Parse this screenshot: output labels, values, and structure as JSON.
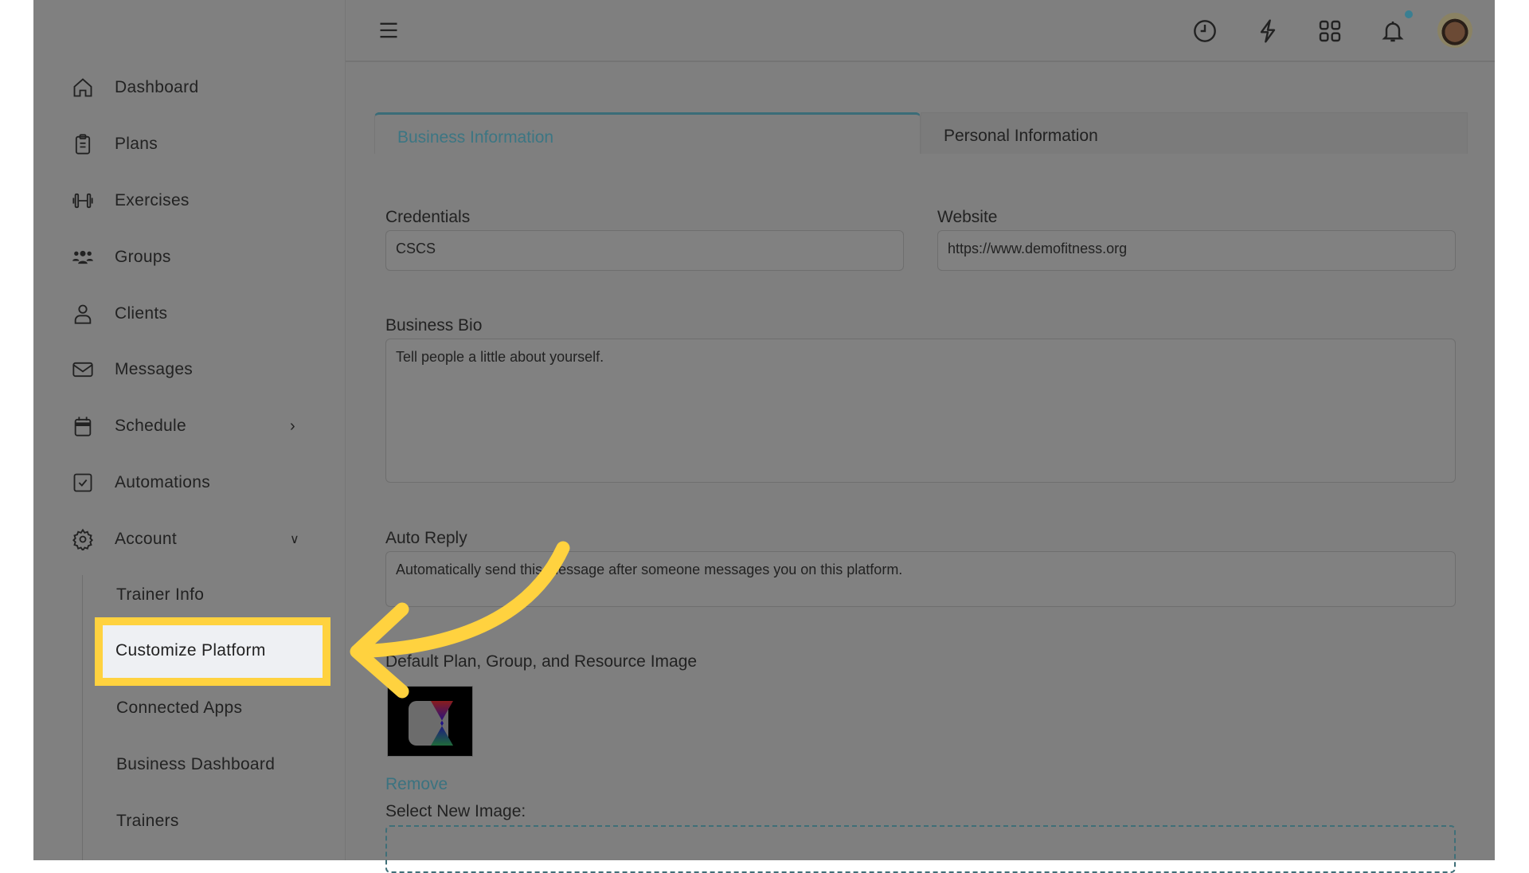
{
  "sidebar": {
    "items": [
      {
        "label": "Dashboard",
        "icon": "home-icon"
      },
      {
        "label": "Plans",
        "icon": "clipboard-icon"
      },
      {
        "label": "Exercises",
        "icon": "dumbbell-icon"
      },
      {
        "label": "Groups",
        "icon": "users-icon"
      },
      {
        "label": "Clients",
        "icon": "user-icon"
      },
      {
        "label": "Messages",
        "icon": "mail-icon"
      },
      {
        "label": "Schedule",
        "icon": "calendar-icon"
      },
      {
        "label": "Automations",
        "icon": "checkbox-icon"
      },
      {
        "label": "Account",
        "icon": "gear-icon"
      }
    ],
    "account_sub": [
      "Trainer Info",
      "Customize Platform",
      "Connected Apps",
      "Business Dashboard",
      "Trainers"
    ]
  },
  "topbar": {
    "icons": [
      "menu-icon",
      "clock-icon",
      "bolt-icon",
      "grid-icon",
      "bell-icon",
      "avatar"
    ]
  },
  "tabs": [
    "Business Information",
    "Personal Information"
  ],
  "form": {
    "credentials_label": "Credentials",
    "credentials_value": "CSCS",
    "website_label": "Website",
    "website_value": "https://www.demofitness.org",
    "bio_label": "Business Bio",
    "bio_placeholder": "Tell people a little about yourself.",
    "auto_reply_label": "Auto Reply",
    "auto_reply_placeholder": "Automatically send this message after someone messages you on this platform.",
    "image_label": "Default Plan, Group, and Resource Image",
    "remove_label": "Remove",
    "select_label": "Select New Image:"
  },
  "colors": {
    "accent": "#3c7683",
    "highlight": "#ffd23f",
    "overlay": "#808080"
  }
}
